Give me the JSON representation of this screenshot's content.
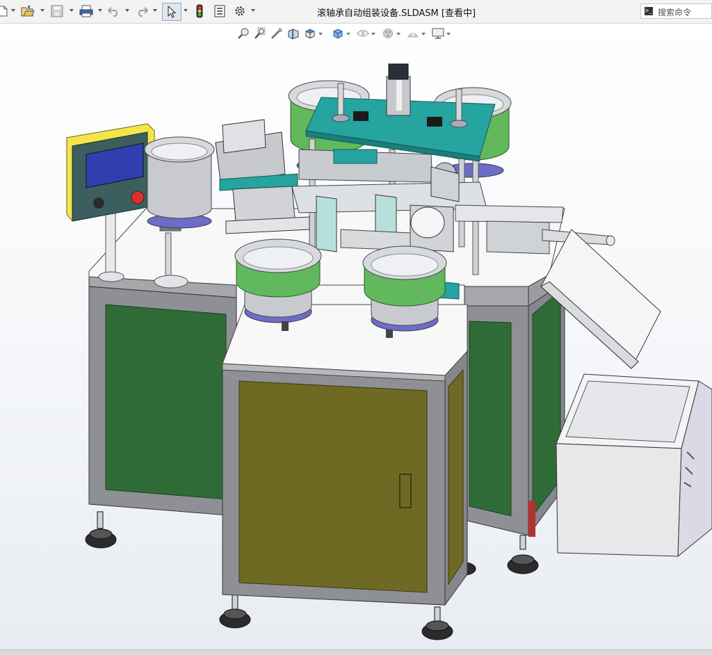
{
  "window": {
    "title": "滚轴承自动组装设备.SLDASM [查看中]"
  },
  "toolbar": {
    "items": [
      {
        "name": "new-icon"
      },
      {
        "name": "open-icon"
      },
      {
        "name": "save-icon"
      },
      {
        "name": "print-icon"
      },
      {
        "name": "undo-icon"
      },
      {
        "name": "redo-icon"
      },
      {
        "name": "select-icon"
      },
      {
        "name": "rebuild-icon"
      },
      {
        "name": "file-properties-icon"
      },
      {
        "name": "options-icon"
      }
    ]
  },
  "search": {
    "placeholder": "搜索命令",
    "prefix": ">_"
  },
  "heads_up": {
    "items": [
      {
        "name": "zoom-to-fit-icon"
      },
      {
        "name": "zoom-to-area-icon"
      },
      {
        "name": "previous-view-icon"
      },
      {
        "name": "section-view-icon"
      },
      {
        "name": "view-orientation-icon"
      },
      {
        "name": "display-style-icon"
      },
      {
        "name": "hide-show-items-icon"
      },
      {
        "name": "edit-appearance-icon"
      },
      {
        "name": "apply-scene-icon"
      },
      {
        "name": "view-settings-icon"
      }
    ]
  },
  "colors": {
    "frame": "#8e9095",
    "panel_green": "#2f6b36",
    "door_olive": "#6e6a24",
    "table_top": "#f8f8f8",
    "bowl_green": "#62b85d",
    "bowl_purple": "#6e6cc6",
    "plate_teal": "#25a4a0",
    "hmi_yellow": "#f4e64a",
    "hmi_screen": "#2f3fb0"
  }
}
